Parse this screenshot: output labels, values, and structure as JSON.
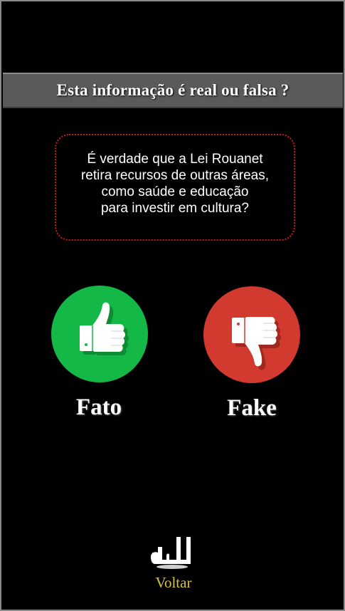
{
  "header": {
    "title": "Esta informação é real ou falsa ?"
  },
  "question": {
    "text": "É verdade que a Lei Rouanet\nretira recursos de outras áreas,\ncomo saúde e educação\npara investir em cultura?"
  },
  "answers": {
    "fato": {
      "label": "Fato",
      "icon": "thumbs-up-icon",
      "color": "#14b846"
    },
    "fake": {
      "label": "Fake",
      "icon": "thumbs-down-icon",
      "color": "#d2392f"
    }
  },
  "footer": {
    "back_label": "Voltar",
    "back_icon": "back-arrow-icon",
    "back_color": "#d8c23a"
  },
  "colors": {
    "background": "#000000",
    "title_bar": "#5a5a5a",
    "question_border": "#c81a1a"
  }
}
